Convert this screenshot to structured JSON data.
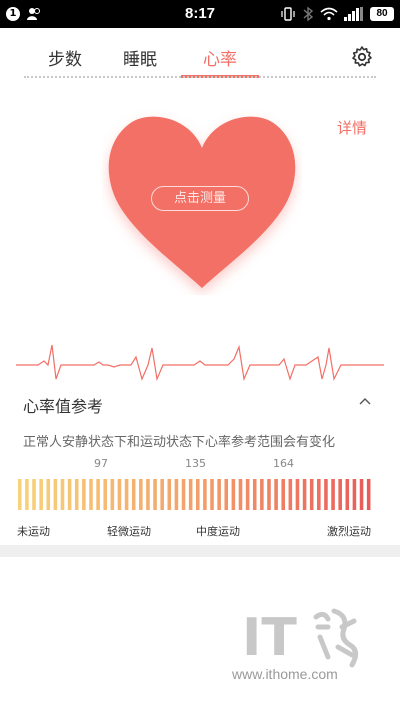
{
  "status_bar": {
    "notification_count": "1",
    "time": "8:17",
    "battery": "80"
  },
  "tabs": [
    {
      "label": "步数"
    },
    {
      "label": "睡眠"
    },
    {
      "label": "心率"
    }
  ],
  "active_tab": "心率",
  "detail_link": "详情",
  "heart": {
    "measure_label": "点击测量",
    "color": "#f26f66"
  },
  "reference": {
    "title": "心率值参考",
    "description": "正常人安静状态下和运动状态下心率参考范围会有变化",
    "thresholds": [
      "97",
      "135",
      "164"
    ],
    "levels": [
      "未运动",
      "轻微运动",
      "中度运动",
      "激烈运动"
    ],
    "gradient_colors": [
      "#f8d27a",
      "#f3a06a",
      "#e95b5b"
    ]
  },
  "watermark": {
    "logo_text": "IT",
    "url": "www.ithome.com"
  },
  "icons": [
    "signal-icon",
    "wifi-icon",
    "bluetooth-icon",
    "vibrate-icon",
    "gear-icon",
    "chevron-up-icon",
    "person-icon"
  ]
}
